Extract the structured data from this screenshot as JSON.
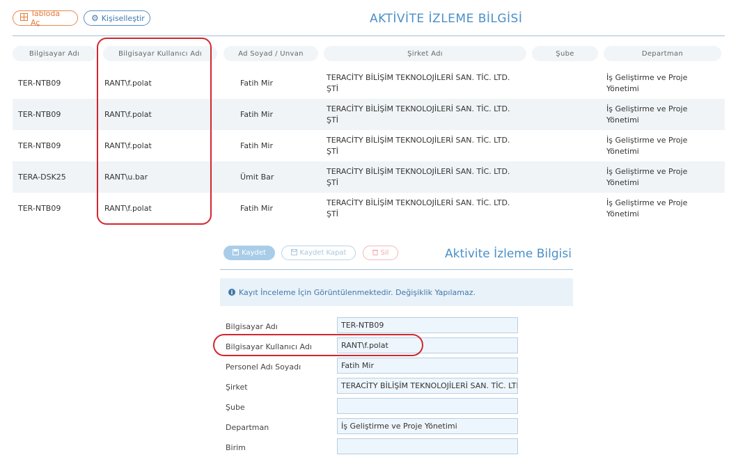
{
  "toolbar": {
    "table_button": "Tabloda Aç",
    "customize_button": "Kişiselleştir",
    "table_icon": "grid-icon",
    "customize_icon": "gear-icon"
  },
  "page_title": "AKTİVİTE İZLEME BİLGİSİ",
  "grid": {
    "columns": [
      "Bilgisayar Adı",
      "Bilgisayar Kullanıcı Adı",
      "Ad Soyad / Unvan",
      "Şirket Adı",
      "Şube",
      "Departman"
    ],
    "rows": [
      {
        "computer": "TER-NTB09",
        "user": "RANT\\f.polat",
        "name": "Fatih Mir",
        "company": "TERACİTY BİLİŞİM TEKNOLOJİLERİ SAN. TİC. LTD. ŞTİ",
        "branch": "",
        "department": "İş Geliştirme ve Proje Yönetimi"
      },
      {
        "computer": "TER-NTB09",
        "user": "RANT\\f.polat",
        "name": "Fatih Mir",
        "company": "TERACİTY BİLİŞİM TEKNOLOJİLERİ SAN. TİC. LTD. ŞTİ",
        "branch": "",
        "department": "İş Geliştirme ve Proje Yönetimi"
      },
      {
        "computer": "TER-NTB09",
        "user": "RANT\\f.polat",
        "name": "Fatih Mir",
        "company": "TERACİTY BİLİŞİM TEKNOLOJİLERİ SAN. TİC. LTD. ŞTİ",
        "branch": "",
        "department": "İş Geliştirme ve Proje Yönetimi"
      },
      {
        "computer": "TERA-DSK25",
        "user": "RANT\\u.bar",
        "name": "Ümit Bar",
        "company": "TERACİTY BİLİŞİM TEKNOLOJİLERİ SAN. TİC. LTD. ŞTİ",
        "branch": "",
        "department": "İş Geliştirme ve Proje Yönetimi"
      },
      {
        "computer": "TER-NTB09",
        "user": "RANT\\f.polat",
        "name": "Fatih Mir",
        "company": "TERACİTY BİLİŞİM TEKNOLOJİLERİ SAN. TİC. LTD. ŞTİ",
        "branch": "",
        "department": "İş Geliştirme ve Proje Yönetimi"
      }
    ]
  },
  "form": {
    "save": "Kaydet",
    "save_close": "Kaydet Kapat",
    "delete": "Sil",
    "title": "Aktivite İzleme Bilgisi",
    "info": "Kayıt İnceleme İçin Görüntülenmektedir. Değişiklik Yapılamaz.",
    "fields": [
      {
        "label": "Bilgisayar Adı",
        "value": "TER-NTB09"
      },
      {
        "label": "Bilgisayar Kullanıcı Adı",
        "value": "RANT\\f.polat"
      },
      {
        "label": "Personel Adı Soyadı",
        "value": "Fatih Mir"
      },
      {
        "label": "Şirket",
        "value": "TERACİTY BİLİŞİM TEKNOLOJİLERİ SAN. TİC. LTD. ŞTİ"
      },
      {
        "label": "Şube",
        "value": ""
      },
      {
        "label": "Departman",
        "value": "İş Geliştirme ve Proje Yönetimi"
      },
      {
        "label": "Birim",
        "value": ""
      }
    ]
  },
  "colors": {
    "accent": "#4a8fc7",
    "highlight_ring": "#d3252c",
    "table_button": "#e07a3a"
  }
}
